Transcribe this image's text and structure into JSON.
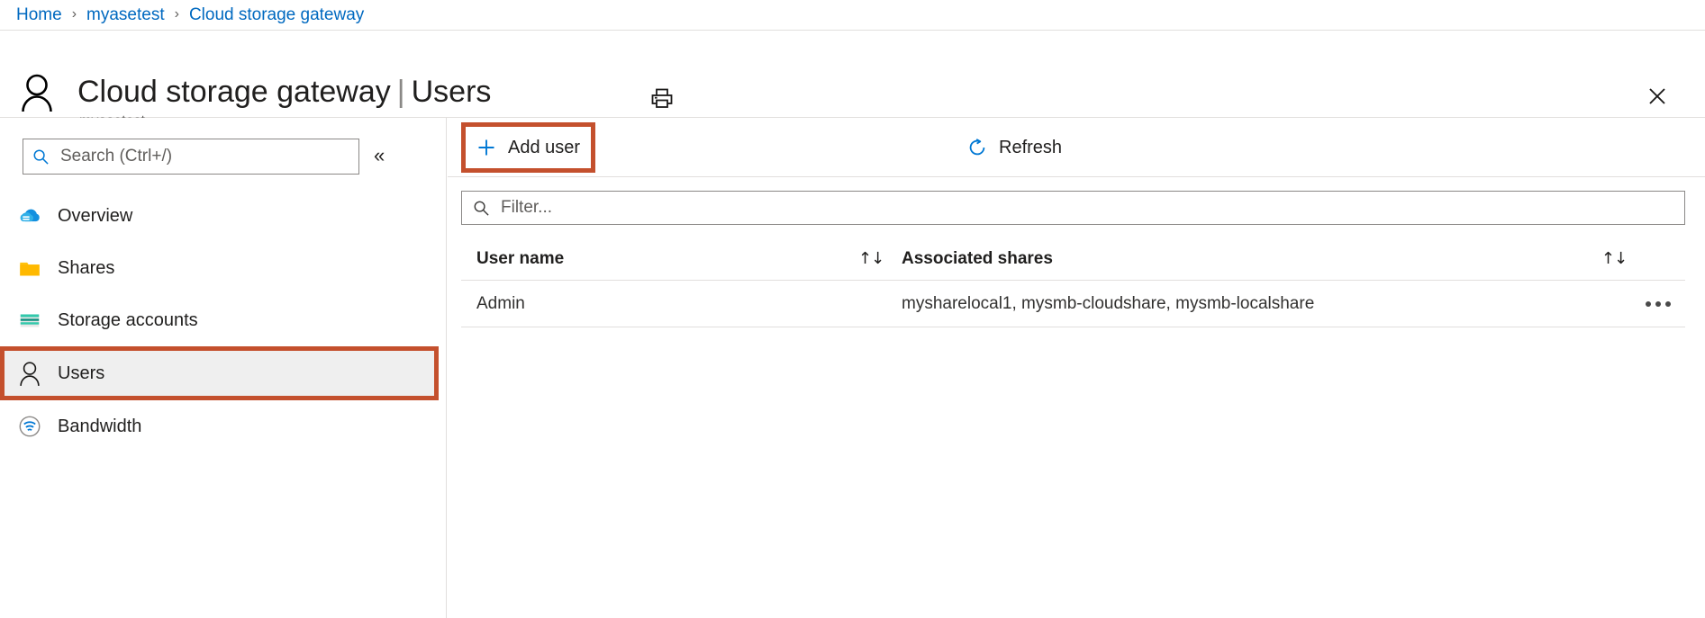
{
  "breadcrumb": {
    "items": [
      {
        "label": "Home"
      },
      {
        "label": "myasetest"
      },
      {
        "label": "Cloud storage gateway"
      }
    ],
    "separator": "›"
  },
  "header": {
    "resource_icon": "user-outline-icon",
    "title": "Cloud storage gateway",
    "divider": "|",
    "section": "Users",
    "subtitle": "myasetest",
    "print_icon": "printer-icon",
    "close_icon": "close-icon"
  },
  "sidebar": {
    "search": {
      "placeholder": "Search (Ctrl+/)",
      "value": "",
      "icon": "search-icon"
    },
    "collapse_icon": "chevron-double-left-icon",
    "collapse_glyph": "«",
    "items": [
      {
        "label": "Overview",
        "icon": "cloud-icon",
        "selected": false
      },
      {
        "label": "Shares",
        "icon": "folder-icon",
        "selected": false
      },
      {
        "label": "Storage accounts",
        "icon": "storage-account-icon",
        "selected": false
      },
      {
        "label": "Users",
        "icon": "user-outline-icon",
        "selected": true
      },
      {
        "label": "Bandwidth",
        "icon": "bandwidth-wifi-icon",
        "selected": false
      }
    ]
  },
  "toolbar": {
    "add_user_label": "Add user",
    "add_user_icon": "plus-icon",
    "refresh_label": "Refresh",
    "refresh_icon": "refresh-icon"
  },
  "filter": {
    "placeholder": "Filter...",
    "value": "",
    "icon": "search-icon"
  },
  "table": {
    "columns": [
      {
        "label": "User name",
        "sort_icon": "sort-updown-icon",
        "sort_glyph": "↑↓"
      },
      {
        "label": "Associated shares",
        "sort_icon": "sort-updown-icon",
        "sort_glyph": "↑↓"
      }
    ],
    "rows": [
      {
        "user_name": "Admin",
        "associated_shares": "mysharelocal1, mysmb-cloudshare, mysmb-localshare",
        "more_icon": "more-actions-icon"
      }
    ]
  },
  "colors": {
    "link": "#0069c0",
    "accent_blue": "#0078d4",
    "highlight_box": "#c4502d",
    "selected_bg": "#efefef",
    "border": "#e1dfdd",
    "text": "#201f1e",
    "muted_text": "#605e5c",
    "folder_yellow": "#ffb900",
    "storage_teal": "#32c8ab"
  }
}
